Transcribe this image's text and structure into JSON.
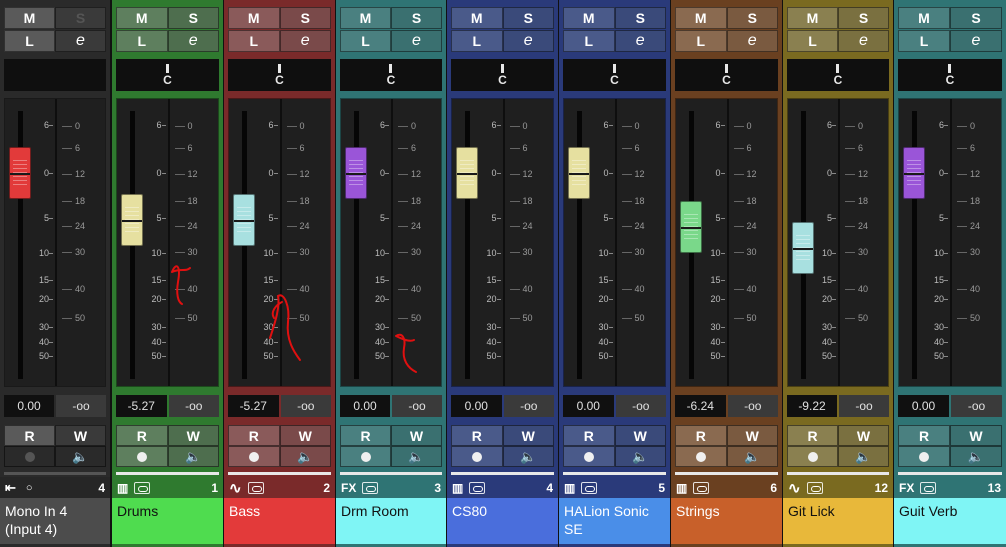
{
  "channels": [
    {
      "m": "M",
      "s": "S",
      "l": "L",
      "e": "e",
      "pan": "",
      "volume": "0.00",
      "peak": "-oo",
      "r": "R",
      "w": "W",
      "type_icon": "",
      "num": "4",
      "name": "Mono In 4 (Input 4)",
      "colors": {
        "base": "#2a2a2a",
        "ml": "#5a5a5a",
        "ms": "#3a3a3a",
        "fader_bg": "#1f1f1f",
        "knob": "#e23a3a",
        "name_bg": "#4c4c4c",
        "name_fg": "#ffffff",
        "hdr": "#262626"
      },
      "fader_db": 0,
      "type": "input",
      "icon_name": "input-icon"
    },
    {
      "m": "M",
      "s": "S",
      "l": "L",
      "e": "e",
      "pan": "C",
      "volume": "-5.27",
      "peak": "-oo",
      "r": "R",
      "w": "W",
      "type_icon": "",
      "num": "1",
      "name": "Drums",
      "colors": {
        "base": "#2f7a2f",
        "ml": "#5e7f5e",
        "ms": "#4e6e4e",
        "knob": "#e6e0a0",
        "name_bg": "#4fdc4f",
        "name_fg": "#111111",
        "hdr": "#2f7a2f"
      },
      "fader_db": -5.27,
      "type": "instrument",
      "icon_name": "instrument-icon"
    },
    {
      "m": "M",
      "s": "S",
      "l": "L",
      "e": "e",
      "pan": "C",
      "volume": "-5.27",
      "peak": "-oo",
      "r": "R",
      "w": "W",
      "type_icon": "",
      "num": "2",
      "name": "Bass",
      "colors": {
        "base": "#7a2a2a",
        "ml": "#8a5a5a",
        "ms": "#7a4a4a",
        "knob": "#a8e0e0",
        "name_bg": "#e33a3a",
        "name_fg": "#ffffff",
        "hdr": "#7a2a2a"
      },
      "fader_db": -5.27,
      "type": "audio",
      "icon_name": "audio-wave-icon"
    },
    {
      "m": "M",
      "s": "S",
      "l": "L",
      "e": "e",
      "pan": "C",
      "volume": "0.00",
      "peak": "-oo",
      "r": "R",
      "w": "W",
      "type_icon": "FX",
      "num": "3",
      "name": "Drm Room",
      "colors": {
        "base": "#2f7474",
        "ml": "#4a8080",
        "ms": "#3a7070",
        "knob": "#9a55d8",
        "name_bg": "#7ff5f5",
        "name_fg": "#111111",
        "hdr": "#2f7474"
      },
      "fader_db": 0,
      "type": "fx",
      "icon_name": "fx-icon"
    },
    {
      "m": "M",
      "s": "S",
      "l": "L",
      "e": "e",
      "pan": "C",
      "volume": "0.00",
      "peak": "-oo",
      "r": "R",
      "w": "W",
      "type_icon": "",
      "num": "4",
      "name": "CS80",
      "colors": {
        "base": "#2a3a7a",
        "ml": "#4a5a8a",
        "ms": "#3a4a7a",
        "knob": "#e6e0a0",
        "name_bg": "#4a6edc",
        "name_fg": "#ffffff",
        "hdr": "#2a3a7a"
      },
      "fader_db": 0,
      "type": "instrument",
      "icon_name": "instrument-icon"
    },
    {
      "m": "M",
      "s": "S",
      "l": "L",
      "e": "e",
      "pan": "C",
      "volume": "0.00",
      "peak": "-oo",
      "r": "R",
      "w": "W",
      "type_icon": "",
      "num": "5",
      "name": "HALion Sonic SE",
      "colors": {
        "base": "#2a3a7a",
        "ml": "#4a5a8a",
        "ms": "#3a4a7a",
        "knob": "#e6e0a0",
        "name_bg": "#4a8ee8",
        "name_fg": "#ffffff",
        "hdr": "#2a3a7a"
      },
      "fader_db": 0,
      "type": "instrument",
      "icon_name": "instrument-icon"
    },
    {
      "m": "M",
      "s": "S",
      "l": "L",
      "e": "e",
      "pan": "C",
      "volume": "-6.24",
      "peak": "-oo",
      "r": "R",
      "w": "W",
      "type_icon": "",
      "num": "6",
      "name": "Strings",
      "colors": {
        "base": "#6a4020",
        "ml": "#8a6a50",
        "ms": "#7a5a40",
        "knob": "#7ad88a",
        "name_bg": "#c8602a",
        "name_fg": "#ffffff",
        "hdr": "#6a4020"
      },
      "fader_db": -6.24,
      "type": "instrument",
      "icon_name": "instrument-icon"
    },
    {
      "m": "M",
      "s": "S",
      "l": "L",
      "e": "e",
      "pan": "C",
      "volume": "-9.22",
      "peak": "-oo",
      "r": "R",
      "w": "W",
      "type_icon": "",
      "num": "12",
      "name": "Git Lick",
      "colors": {
        "base": "#7a6a20",
        "ml": "#8a8050",
        "ms": "#7a7040",
        "knob": "#a8e0e0",
        "name_bg": "#e8b83a",
        "name_fg": "#111111",
        "hdr": "#7a6a20"
      },
      "fader_db": -9.22,
      "type": "audio",
      "icon_name": "audio-wave-icon"
    },
    {
      "m": "M",
      "s": "S",
      "l": "L",
      "e": "e",
      "pan": "C",
      "volume": "0.00",
      "peak": "-oo",
      "r": "R",
      "w": "W",
      "type_icon": "FX",
      "num": "13",
      "name": "Guit Verb",
      "colors": {
        "base": "#2f7474",
        "ml": "#4a8080",
        "ms": "#3a7070",
        "knob": "#9a55d8",
        "name_bg": "#7ff5f5",
        "name_fg": "#111111",
        "hdr": "#2f7474"
      },
      "fader_db": 0,
      "type": "fx",
      "icon_name": "fx-icon"
    }
  ],
  "fader_scale": [
    "6",
    "0",
    "5",
    "10",
    "15",
    "20",
    "30",
    "40",
    "50"
  ],
  "meter_scale": [
    "0",
    "6",
    "12",
    "18",
    "24",
    "30",
    "40",
    "50"
  ],
  "annotations": {
    "color": "#e01010",
    "count": 4
  }
}
